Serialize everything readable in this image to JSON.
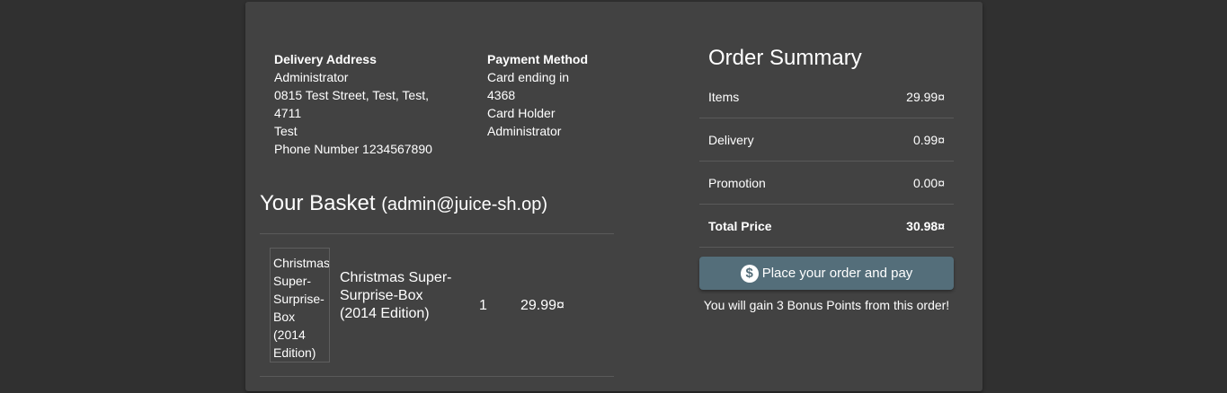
{
  "delivery": {
    "heading": "Delivery Address",
    "name": "Administrator",
    "street": "0815 Test Street, Test, Test,",
    "zip": "4711",
    "country": "Test",
    "phone": "Phone Number 1234567890"
  },
  "payment": {
    "heading": "Payment Method",
    "card_line1": "Card ending in",
    "card_line2": "4368",
    "holder_label": "Card Holder",
    "holder_name": "Administrator"
  },
  "basket": {
    "title": "Your Basket",
    "email": "(admin@juice-sh.op)",
    "items": [
      {
        "image_alt": "Christmas Super-Surprise-Box (2014 Edition)",
        "name": "Christmas Super-Surprise-Box (2014 Edition)",
        "quantity": "1",
        "price": "29.99¤"
      }
    ]
  },
  "summary": {
    "title": "Order Summary",
    "rows": [
      {
        "label": "Items",
        "value": "29.99¤"
      },
      {
        "label": "Delivery",
        "value": "0.99¤"
      },
      {
        "label": "Promotion",
        "value": "0.00¤"
      },
      {
        "label": "Total Price",
        "value": "30.98¤"
      }
    ],
    "pay_button": "Place your order and pay",
    "pay_icon": "dollar-icon",
    "bonus_text": "You will gain 3 Bonus Points from this order!"
  },
  "colors": {
    "page_bg": "#303030",
    "card_bg": "#424242",
    "button_bg": "#546e7a"
  }
}
